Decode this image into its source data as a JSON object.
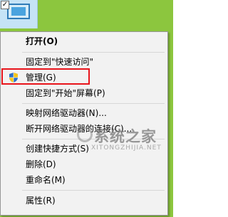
{
  "desktop": {
    "icon_name": "this-pc-icon",
    "selection_checked": "✓"
  },
  "menu": {
    "items": [
      {
        "label": "打开(O)",
        "bold": true
      },
      {
        "label": "固定到\"快速访问\""
      },
      {
        "label": "管理(G)",
        "icon": "uac-shield-icon",
        "highlighted": true
      },
      {
        "label": "固定到\"开始\"屏幕(P)"
      },
      {
        "label": "映射网络驱动器(N)..."
      },
      {
        "label": "断开网络驱动器的连接(C)..."
      },
      {
        "label": "创建快捷方式(S)"
      },
      {
        "label": "删除(D)"
      },
      {
        "label": "重命名(M)"
      },
      {
        "label": "属性(R)"
      }
    ]
  },
  "watermark": {
    "title": "系统之家",
    "url": "XITONGZHIJIA.NET"
  },
  "colors": {
    "menu_background": "#f2f2f2",
    "highlight_border": "#e8141b",
    "desktop_green": "#8cc63e"
  }
}
